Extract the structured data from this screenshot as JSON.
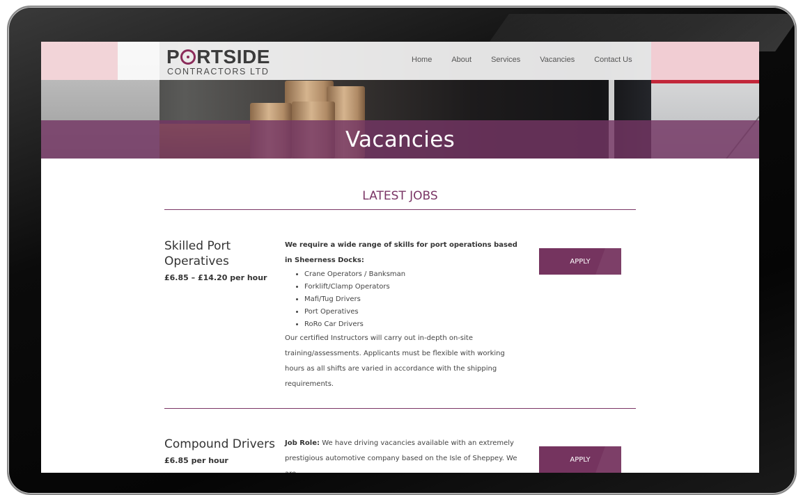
{
  "site": {
    "logo_main": "PORTSIDE",
    "logo_sub": "CONTRACTORS LTD"
  },
  "nav": {
    "items": [
      {
        "label": "Home"
      },
      {
        "label": "About"
      },
      {
        "label": "Services"
      },
      {
        "label": "Vacancies"
      },
      {
        "label": "Contact Us"
      }
    ]
  },
  "hero": {
    "title": "Vacancies"
  },
  "section": {
    "title": "LATEST JOBS"
  },
  "jobs": [
    {
      "title": "Skilled Port Operatives",
      "pay": "£6.85 – £14.20 per hour",
      "intro": "We require a wide range of skills for port operations based in Sheerness Docks:",
      "list": [
        "Crane Operators / Banksman",
        "Forklift/Clamp Operators",
        "Mafi/Tug Drivers",
        "Port Operatives",
        "RoRo Car Drivers"
      ],
      "body": "Our certified Instructors will carry out in-depth on-site training/assessments.  Applicants must be flexible with working hours as all shifts are varied in accordance with the shipping requirements.",
      "apply_label": "APPLY"
    },
    {
      "title": "Compound Drivers",
      "pay": "£6.85 per hour",
      "role_label": "Job Role:",
      "body": "We have driving vacancies available with an extremely prestigious automotive company based on the Isle of Sheppey. We are",
      "apply_label": "APPLY"
    }
  ],
  "colors": {
    "accent": "#75345f",
    "title_band": "#743664",
    "text": "#444444"
  }
}
